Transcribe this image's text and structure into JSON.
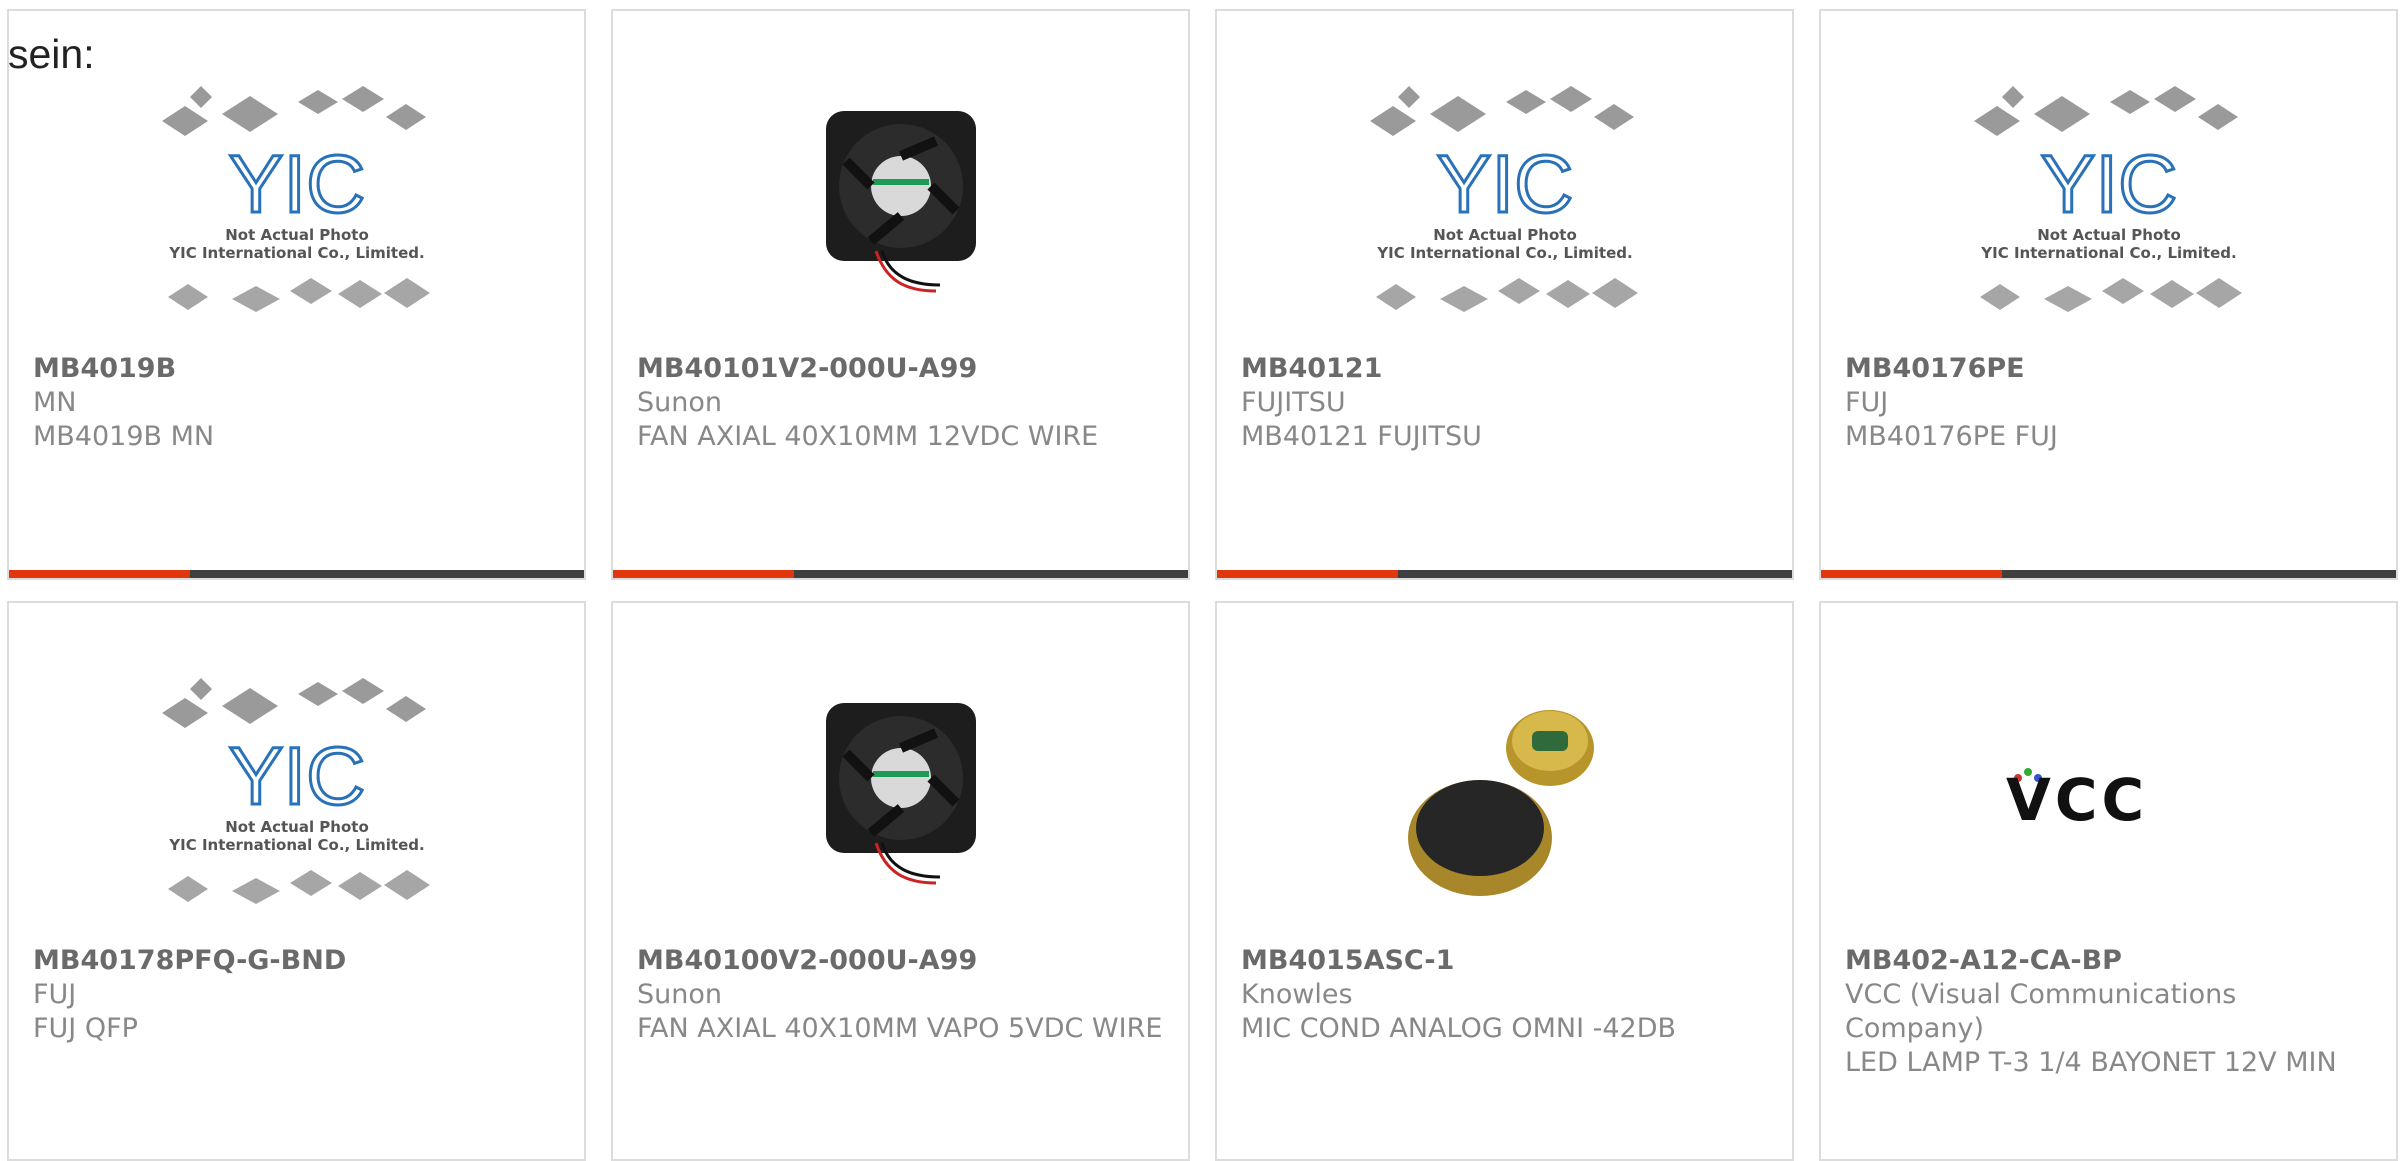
{
  "lead_text": "sein:",
  "placeholder": {
    "line1": "Not Actual Photo",
    "line2": "YIC International Co., Limited.",
    "logo": "YIC"
  },
  "vcc_logo": "VCC",
  "colors": {
    "accent": "#e0370d",
    "bar": "#3f3f3f",
    "yic_blue": "#2a72b8"
  },
  "products": [
    {
      "part": "MB4019B",
      "mfr": "MN",
      "desc": "MB4019B MN",
      "image": "yic-placeholder"
    },
    {
      "part": "MB40101V2-000U-A99",
      "mfr": "Sunon",
      "desc": "FAN AXIAL 40X10MM 12VDC WIRE",
      "image": "fan"
    },
    {
      "part": "MB40121",
      "mfr": "FUJITSU",
      "desc": "MB40121 FUJITSU",
      "image": "yic-placeholder"
    },
    {
      "part": "MB40176PE",
      "mfr": "FUJ",
      "desc": "MB40176PE FUJ",
      "image": "yic-placeholder"
    },
    {
      "part": "MB40178PFQ-G-BND",
      "mfr": "FUJ",
      "desc": "FUJ QFP",
      "image": "yic-placeholder"
    },
    {
      "part": "MB40100V2-000U-A99",
      "mfr": "Sunon",
      "desc": "FAN AXIAL 40X10MM VAPO 5VDC WIRE",
      "image": "fan"
    },
    {
      "part": "MB4015ASC-1",
      "mfr": "Knowles",
      "desc": "MIC COND ANALOG OMNI -42DB",
      "image": "microphone"
    },
    {
      "part": "MB402-A12-CA-BP",
      "mfr": "VCC (Visual Communications Company)",
      "desc": "LED LAMP T-3 1/4 BAYONET 12V MIN",
      "image": "vcc-logo"
    }
  ]
}
